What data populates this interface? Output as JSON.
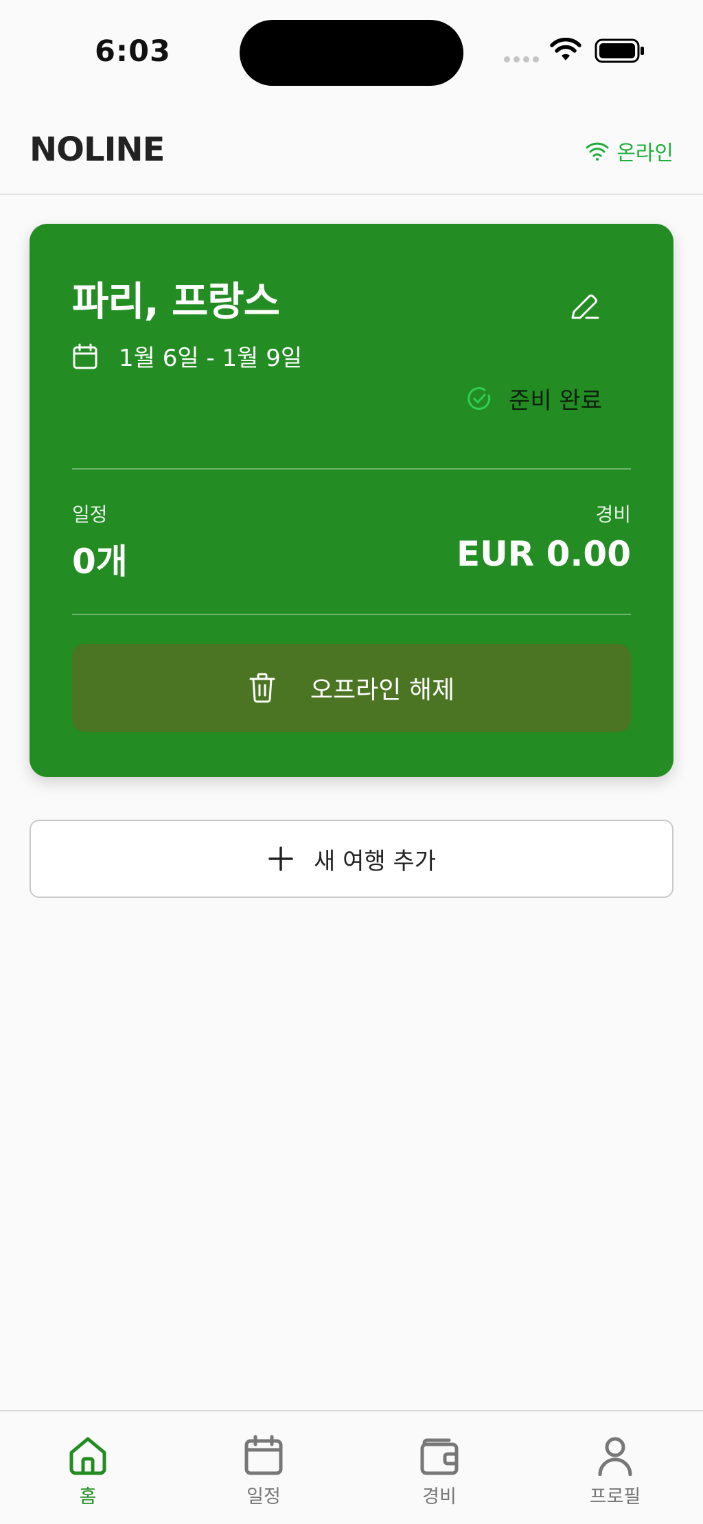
{
  "status_bar": {
    "time": "6:03"
  },
  "header": {
    "app_title": "NOLINE",
    "connection_label": "온라인"
  },
  "trip_card": {
    "destination": "파리, 프랑스",
    "date_range": "1월 6일 - 1월 9일",
    "status_text": "준비 완료",
    "schedule_label": "일정",
    "schedule_value": "0개",
    "expense_label": "경비",
    "expense_value": "EUR 0.00",
    "offline_button_label": "오프라인 해제"
  },
  "add_trip_label": "새 여행 추가",
  "tab_bar": {
    "tabs": [
      {
        "label": "홈",
        "icon": "home-icon",
        "active": true
      },
      {
        "label": "일정",
        "icon": "calendar-icon",
        "active": false
      },
      {
        "label": "경비",
        "icon": "wallet-icon",
        "active": false
      },
      {
        "label": "프로필",
        "icon": "profile-icon",
        "active": false
      }
    ]
  },
  "colors": {
    "card_background": "#238c23",
    "offline_button": "#4c7523",
    "online_green": "#1fae3a",
    "tab_active": "#238c23",
    "tab_inactive": "#777777"
  }
}
